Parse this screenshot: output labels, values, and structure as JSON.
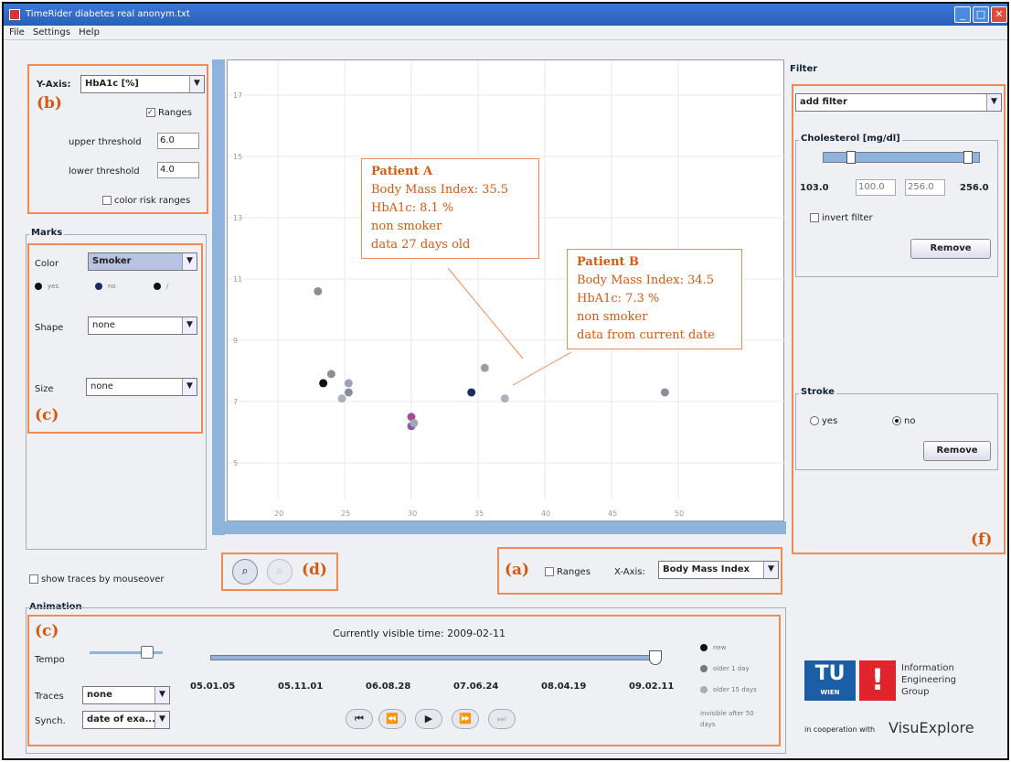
{
  "window": {
    "title": "TimeRider   diabetes real anonym.txt"
  },
  "menu": [
    "File",
    "Settings",
    "Help"
  ],
  "yaxis": {
    "label": "Y-Axis:",
    "value": "HbA1c [%]",
    "ranges_label": "Ranges",
    "upper_label": "upper threshold",
    "upper_value": "6.0",
    "lower_label": "lower threshold",
    "lower_value": "4.0",
    "color_risk": "color risk ranges"
  },
  "marks": {
    "title": "Marks",
    "color_label": "Color",
    "color_value": "Smoker",
    "legend": [
      "yes",
      "no",
      "/"
    ],
    "shape_label": "Shape",
    "shape_value": "none",
    "size_label": "Size",
    "size_value": "none"
  },
  "show_traces": "show traces by mouseover",
  "labels": {
    "a": "(a)",
    "b": "(b)",
    "c1": "(c)",
    "c2": "(c)",
    "d": "(d)",
    "f": "(f)"
  },
  "xaxis_panel": {
    "ranges": "Ranges",
    "xaxis_label": "X-Axis:",
    "xaxis_value": "Body Mass Index"
  },
  "plot": {
    "yticks": [
      "17",
      "15",
      "13",
      "11",
      "9",
      "7",
      "5"
    ],
    "xticks": [
      "20",
      "25",
      "30",
      "35",
      "40",
      "45",
      "50"
    ],
    "points": [
      {
        "x": 23,
        "y": 10.6,
        "c": "#8a8f96"
      },
      {
        "x": 24,
        "y": 7.9,
        "c": "#8a8f96"
      },
      {
        "x": 23.4,
        "y": 7.6,
        "c": "#111111"
      },
      {
        "x": 25.3,
        "y": 7.6,
        "c": "#9aa6b5"
      },
      {
        "x": 25.3,
        "y": 7.3,
        "c": "#8a8f96"
      },
      {
        "x": 24.8,
        "y": 7.1,
        "c": "#a9b3c0"
      },
      {
        "x": 34.5,
        "y": 7.3,
        "c": "#1d2f5e"
      },
      {
        "x": 35.5,
        "y": 8.1,
        "c": "#9aa0a8"
      },
      {
        "x": 37,
        "y": 7.1,
        "c": "#a9b3c0"
      },
      {
        "x": 49,
        "y": 7.3,
        "c": "#8a8f96"
      },
      {
        "x": 30,
        "y": 6.5,
        "c": "#a84a9a"
      },
      {
        "x": 30,
        "y": 6.2,
        "c": "#8a5aa8"
      },
      {
        "x": 30.2,
        "y": 6.3,
        "c": "#a0aab6"
      }
    ]
  },
  "patient_a": {
    "title": "Patient A",
    "bmi": "Body Mass Index: 35.5",
    "hba1c": "HbA1c: 8.1 %",
    "smoker": "non smoker",
    "age": "data 27 days old"
  },
  "patient_b": {
    "title": "Patient B",
    "bmi": "Body Mass Index: 34.5",
    "hba1c": "HbA1c: 7.3 %",
    "smoker": "non smoker",
    "age": "data from current date"
  },
  "filter": {
    "title": "Filter",
    "add": "add filter",
    "chol_title": "Cholesterol [mg/dl]",
    "min": "103.0",
    "lo": "100.0",
    "hi": "256.0",
    "max": "256.0",
    "invert": "invert filter",
    "remove": "Remove",
    "stroke_title": "Stroke",
    "yes": "yes",
    "no": "no",
    "remove2": "Remove"
  },
  "animation": {
    "title": "Animation",
    "current": "Currently visible time: 2009-02-11",
    "tempo": "Tempo",
    "traces_label": "Traces",
    "traces_value": "none",
    "synch_label": "Synch.",
    "synch_value": "date of exa...",
    "dates": [
      "05.01.05",
      "05.11.01",
      "06.08.28",
      "07.06.24",
      "08.04.19",
      "09.02.11"
    ],
    "legend": [
      "new",
      "older 1 day",
      "older 15 days"
    ],
    "invisible": "invisible after 50 days"
  },
  "branding": {
    "tu": "TU",
    "wien": "WIEN",
    "ieg": "Information Engineering Group",
    "coop": "in cooperation with",
    "visu": "VisuExplore"
  }
}
